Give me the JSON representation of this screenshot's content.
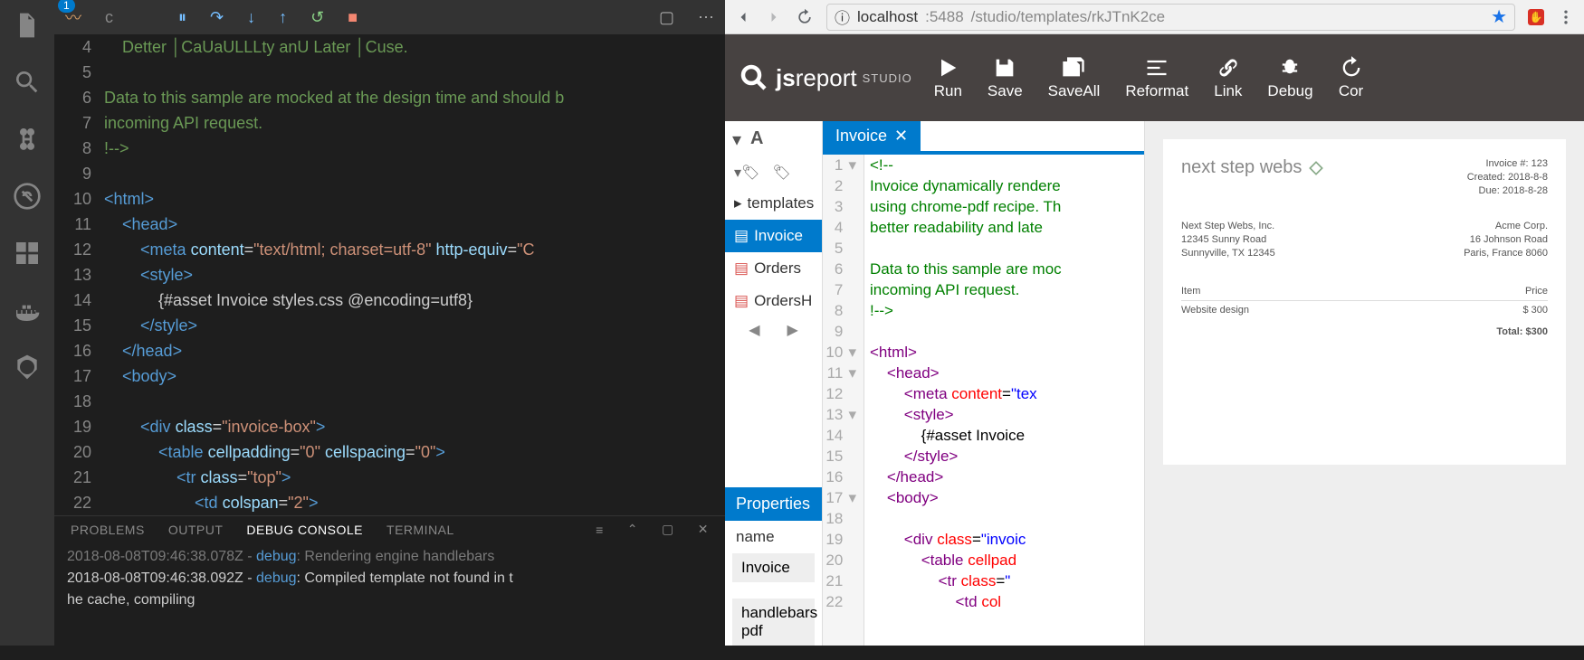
{
  "vscode": {
    "activityBadge": "1",
    "debugToolbar": {
      "pause": "⏸",
      "stepOver": "↷",
      "stepInto": "↓",
      "stepOut": "↑",
      "restart": "↺",
      "stop": "■"
    },
    "glyph": "〰",
    "layoutGlyph": "▢",
    "moreGlyph": "⋯",
    "gutter": [
      "4",
      "5",
      "6",
      "7",
      "8",
      "9",
      "10",
      "11",
      "12",
      "13",
      "14",
      "15",
      "16",
      "17",
      "18",
      "19",
      "20",
      "21",
      "22"
    ],
    "codeLines": [
      {
        "cls": "c",
        "html": "    Detter │CaUaULLLty anU Later │Cuse."
      },
      {
        "cls": "c",
        "html": ""
      },
      {
        "cls": "c",
        "html": "Data to this sample are mocked at the design time and should b"
      },
      {
        "cls": "c",
        "html": "incoming API request."
      },
      {
        "cls": "c",
        "html": "!-->"
      },
      {
        "cls": "",
        "html": ""
      },
      {
        "cls": "",
        "html": "<span class=t>&lt;html&gt;</span>"
      },
      {
        "cls": "",
        "html": "    <span class=t>&lt;head&gt;</span>"
      },
      {
        "cls": "",
        "html": "        <span class=t>&lt;meta</span> <span class=a>content</span>=<span class=s>\"text/html; charset=utf-8\"</span> <span class=a>http-equiv</span>=<span class=s>\"C</span>"
      },
      {
        "cls": "",
        "html": "        <span class=t>&lt;style&gt;</span>"
      },
      {
        "cls": "",
        "html": "            {#asset Invoice styles.css @encoding=utf8}"
      },
      {
        "cls": "",
        "html": "        <span class=t>&lt;/style&gt;</span>"
      },
      {
        "cls": "",
        "html": "    <span class=t>&lt;/head&gt;</span>"
      },
      {
        "cls": "",
        "html": "    <span class=t>&lt;body&gt;</span>"
      },
      {
        "cls": "",
        "html": "    "
      },
      {
        "cls": "",
        "html": "        <span class=t>&lt;div</span> <span class=a>class</span>=<span class=s>\"invoice-box\"</span><span class=t>&gt;</span>"
      },
      {
        "cls": "",
        "html": "            <span class=t>&lt;table</span> <span class=a>cellpadding</span>=<span class=s>\"0\"</span> <span class=a>cellspacing</span>=<span class=s>\"0\"</span><span class=t>&gt;</span>"
      },
      {
        "cls": "",
        "html": "                <span class=t>&lt;tr</span> <span class=a>class</span>=<span class=s>\"top\"</span><span class=t>&gt;</span>"
      },
      {
        "cls": "",
        "html": "                    <span class=t>&lt;td</span> <span class=a>colspan</span>=<span class=s>\"2\"</span><span class=t>&gt;</span>"
      }
    ],
    "panel": {
      "tabs": {
        "problems": "PROBLEMS",
        "output": "OUTPUT",
        "debugConsole": "DEBUG CONSOLE",
        "terminal": "TERMINAL"
      },
      "lines": [
        "<span class=dim>2018-08-08T09:46:38.078Z - </span><span class=debug>debug</span><span class=dim>: Rendering engine handlebars</span>",
        "2018-08-08T09:46:38.092Z - <span class=debug>debug</span>: Compiled template not found in t",
        "he cache, compiling"
      ]
    }
  },
  "browser": {
    "url": {
      "host": "localhost",
      "port": ":5488",
      "path": "/studio/templates/rkJTnK2ce"
    }
  },
  "jsr": {
    "logo": {
      "js": "js",
      "report": "report",
      "studio": "STUDIO"
    },
    "actions": {
      "run": "Run",
      "save": "Save",
      "saveAll": "SaveAll",
      "reformat": "Reformat",
      "link": "Link",
      "debug": "Debug",
      "cor": "Cor"
    },
    "tree": {
      "templates": "templates",
      "invoice": "Invoice",
      "orders": "Orders",
      "ordersH": "OrdersH"
    },
    "properties": {
      "header": "Properties",
      "nameLabel": "name",
      "nameValue": "Invoice",
      "engine": "handlebars",
      "recipe": "pdf"
    },
    "tab": {
      "label": "Invoice"
    },
    "gutter": [
      "1",
      "2",
      "3",
      "4",
      "5",
      "6",
      "7",
      "8",
      "9",
      "10",
      "11",
      "12",
      "13",
      "14",
      "15",
      "16",
      "17",
      "18",
      "19",
      "20",
      "21",
      "22"
    ],
    "codeLines": [
      "<span class=cm>&lt;!--</span>",
      "<span class=cm>Invoice dynamically rendere</span>",
      "<span class=cm>using chrome-pdf recipe. Th</span>",
      "<span class=cm>better readability and late</span>",
      "",
      "<span class=cm>Data to this sample are moc</span>",
      "<span class=cm>incoming API request.</span>",
      "<span class=cm>!--&gt;</span>",
      "",
      "<span class=tag>&lt;html&gt;</span>",
      "    <span class=tag>&lt;head&gt;</span>",
      "        <span class=tag>&lt;meta</span> <span class=attr>content</span>=<span class=str>\"tex</span>",
      "        <span class=tag>&lt;style&gt;</span>",
      "            {#asset Invoice",
      "        <span class=tag>&lt;/style&gt;</span>",
      "    <span class=tag>&lt;/head&gt;</span>",
      "    <span class=tag>&lt;body&gt;</span>",
      "",
      "        <span class=tag>&lt;div</span> <span class=attr>class</span>=<span class=str>\"invoic</span>",
      "            <span class=tag>&lt;table</span> <span class=attr>cellpad</span>",
      "                <span class=tag>&lt;tr</span> <span class=attr>class</span>=<span class=str>\"</span>",
      "                    <span class=tag>&lt;td</span> <span class=attr>col</span>"
    ]
  },
  "invoice": {
    "logo": "next step webs",
    "meta": {
      "number": "Invoice #: 123",
      "created": "Created: 2018-8-8",
      "due": "Due: 2018-8-28"
    },
    "from": {
      "l1": "Next Step Webs, Inc.",
      "l2": "12345 Sunny Road",
      "l3": "Sunnyville, TX 12345"
    },
    "to": {
      "l1": "Acme Corp.",
      "l2": "16 Johnson Road",
      "l3": "Paris, France 8060"
    },
    "cols": {
      "item": "Item",
      "price": "Price"
    },
    "row": {
      "item": "Website design",
      "price": "$ 300"
    },
    "total": {
      "label": "Total:",
      "value": "$300"
    }
  }
}
